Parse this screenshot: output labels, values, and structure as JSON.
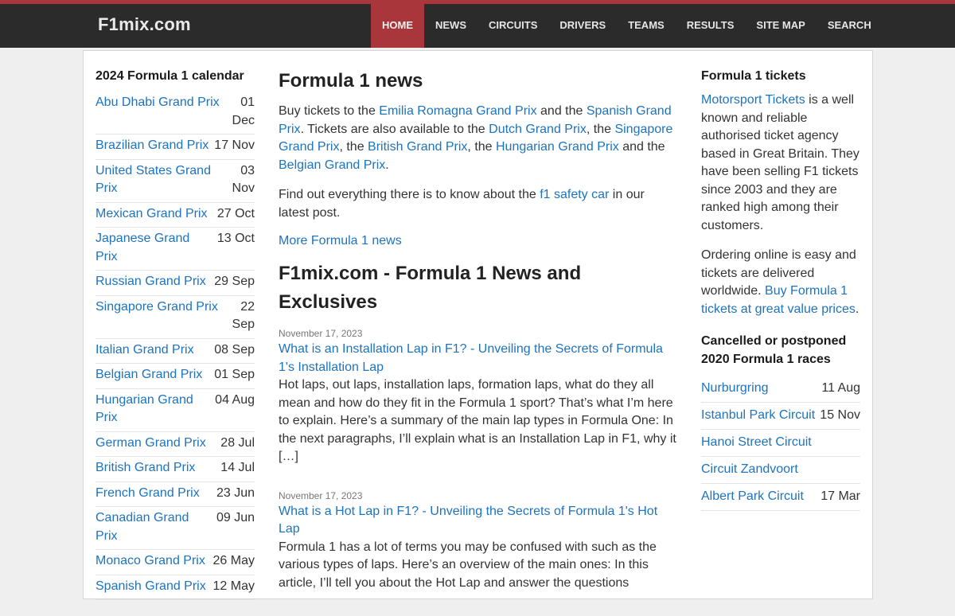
{
  "header": {
    "logo": "F1mix.com",
    "nav": [
      "HOME",
      "NEWS",
      "CIRCUITS",
      "DRIVERS",
      "TEAMS",
      "RESULTS",
      "SITE MAP",
      "SEARCH"
    ],
    "active": "HOME"
  },
  "calendar": {
    "title": "2024 Formula 1 calendar",
    "races": [
      {
        "name": "Abu Dhabi Grand Prix",
        "date": "01 Dec"
      },
      {
        "name": "Brazilian Grand Prix",
        "date": "17 Nov"
      },
      {
        "name": "United States Grand Prix",
        "date": "03 Nov"
      },
      {
        "name": "Mexican Grand Prix",
        "date": "27 Oct"
      },
      {
        "name": "Japanese Grand Prix",
        "date": "13 Oct"
      },
      {
        "name": "Russian Grand Prix",
        "date": "29 Sep"
      },
      {
        "name": "Singapore Grand Prix",
        "date": "22 Sep"
      },
      {
        "name": "Italian Grand Prix",
        "date": "08 Sep"
      },
      {
        "name": "Belgian Grand Prix",
        "date": "01 Sep"
      },
      {
        "name": "Hungarian Grand Prix",
        "date": "04 Aug"
      },
      {
        "name": "German Grand Prix",
        "date": "28 Jul"
      },
      {
        "name": "British Grand Prix",
        "date": "14 Jul"
      },
      {
        "name": "French Grand Prix",
        "date": "23 Jun"
      },
      {
        "name": "Canadian Grand Prix",
        "date": "09 Jun"
      },
      {
        "name": "Monaco Grand Prix",
        "date": "26 May"
      },
      {
        "name": "Spanish Grand Prix",
        "date": "12 May"
      }
    ]
  },
  "main": {
    "news_title": "Formula 1 news",
    "p1": {
      "t1": "Buy tickets to the ",
      "l1": "Emilia Romagna Grand Prix",
      "t2": " and the ",
      "l2": "Spanish Grand Prix",
      "t3": ". Tickets are also available to the ",
      "l3": "Dutch Grand Prix",
      "t4": ", the ",
      "l4": "Singapore Grand Prix",
      "t5": ", the ",
      "l5": "British Grand Prix",
      "t6": ", the ",
      "l6": "Hungarian Grand Prix",
      "t7": " and the ",
      "l7": "Belgian Grand Prix",
      "t8": "."
    },
    "p2": {
      "t1": "Find out everything there is to know about the ",
      "l1": "f1 safety car",
      "t2": " in our latest post."
    },
    "more_news": "More Formula 1 news",
    "site_title": "F1mix.com - Formula 1 News and Exclusives",
    "posts": [
      {
        "date": "November 17, 2023",
        "title": "What is an Installation Lap in F1? - Unveiling the Secrets of Formula 1's Installation Lap",
        "excerpt": "Hot laps, out laps, installation laps, formation laps, what do they all mean and how do they fit in the Formula 1 sport? That’s what I’m here to explain. Here’s a summary of the main lap types in Formula One: In the next paragraphs, I’ll explain what is an Installation Lap in F1, why it […]"
      },
      {
        "date": "November 17, 2023",
        "title": "What is a Hot Lap in F1? - Unveiling the Secrets of Formula 1's Hot Lap",
        "excerpt": "Formula 1 has a lot of terms you may be confused with such as the various types of laps. Here’s an overview of the main ones: In this article, I’ll tell you about the Hot Lap and answer the questions"
      }
    ]
  },
  "right": {
    "tickets_title": "Formula 1 tickets",
    "p1": {
      "l1": "Motorsport Tickets",
      "t1": " is a well known and reliable authorised ticket agency based in Great Britain. They have been selling F1 tickets since 2003 and they are ranked high among their customers."
    },
    "p2": {
      "t1": "Ordering online is easy and tickets are delivered worldwide. ",
      "l1": "Buy Formula 1 tickets at great value prices",
      "t2": "."
    },
    "cancelled_title": "Cancelled or postponed 2020 Formula 1 races",
    "cancelled": [
      {
        "name": "Nurburgring",
        "date": "11 Aug"
      },
      {
        "name": "Istanbul Park Circuit",
        "date": "15 Nov"
      },
      {
        "name": "Hanoi Street Circuit",
        "date": ""
      },
      {
        "name": "Circuit Zandvoort",
        "date": ""
      },
      {
        "name": "Albert Park Circuit",
        "date": "17 Mar"
      }
    ]
  }
}
